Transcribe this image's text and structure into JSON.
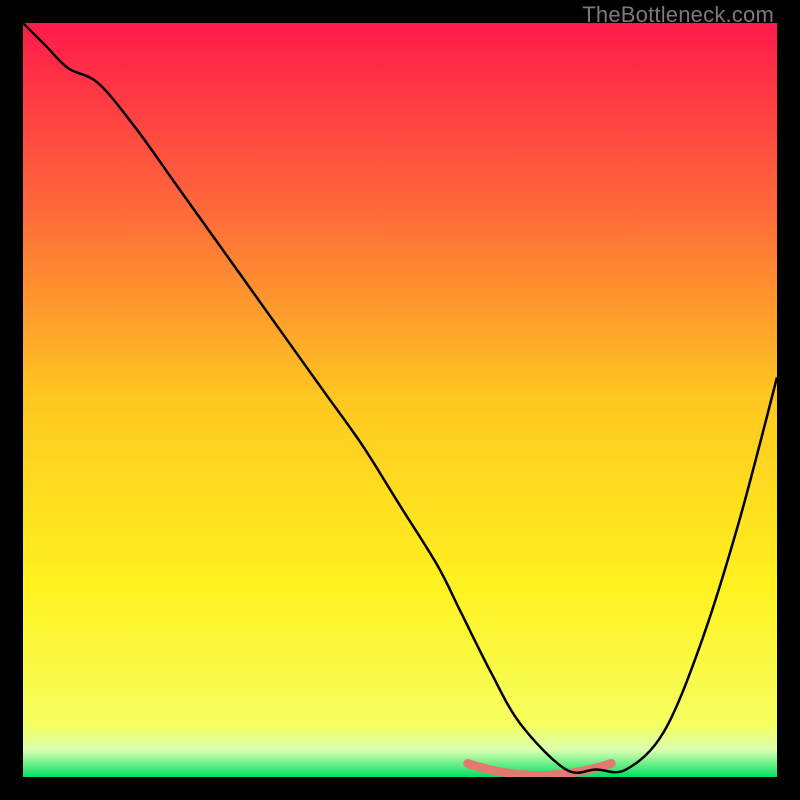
{
  "attribution": "TheBottleneck.com",
  "chart_data": {
    "type": "line",
    "title": "",
    "xlabel": "",
    "ylabel": "",
    "xlim": [
      0,
      100
    ],
    "ylim": [
      0,
      100
    ],
    "background_gradient": {
      "stops": [
        {
          "pos": 0.0,
          "color": "#ff1a4a"
        },
        {
          "pos": 0.25,
          "color": "#ff6a3a"
        },
        {
          "pos": 0.5,
          "color": "#ffc820"
        },
        {
          "pos": 0.75,
          "color": "#fff220"
        },
        {
          "pos": 0.93,
          "color": "#f6ff60"
        },
        {
          "pos": 0.965,
          "color": "#d8ffb0"
        },
        {
          "pos": 1.0,
          "color": "#00e060"
        }
      ]
    },
    "curve": {
      "x": [
        0,
        3,
        6,
        10,
        15,
        20,
        25,
        30,
        35,
        40,
        45,
        50,
        55,
        58,
        62,
        66,
        72,
        76,
        80,
        85,
        90,
        95,
        100
      ],
      "y": [
        100,
        97,
        94,
        92,
        86,
        79,
        72,
        65,
        58,
        51,
        44,
        36,
        28,
        22,
        14,
        7,
        1,
        1,
        1,
        6,
        18,
        34,
        53
      ]
    },
    "bottom_band": {
      "color": "#e3796f",
      "thickness_px": 9,
      "x_start": 59,
      "x_end": 78,
      "y": 1
    }
  }
}
